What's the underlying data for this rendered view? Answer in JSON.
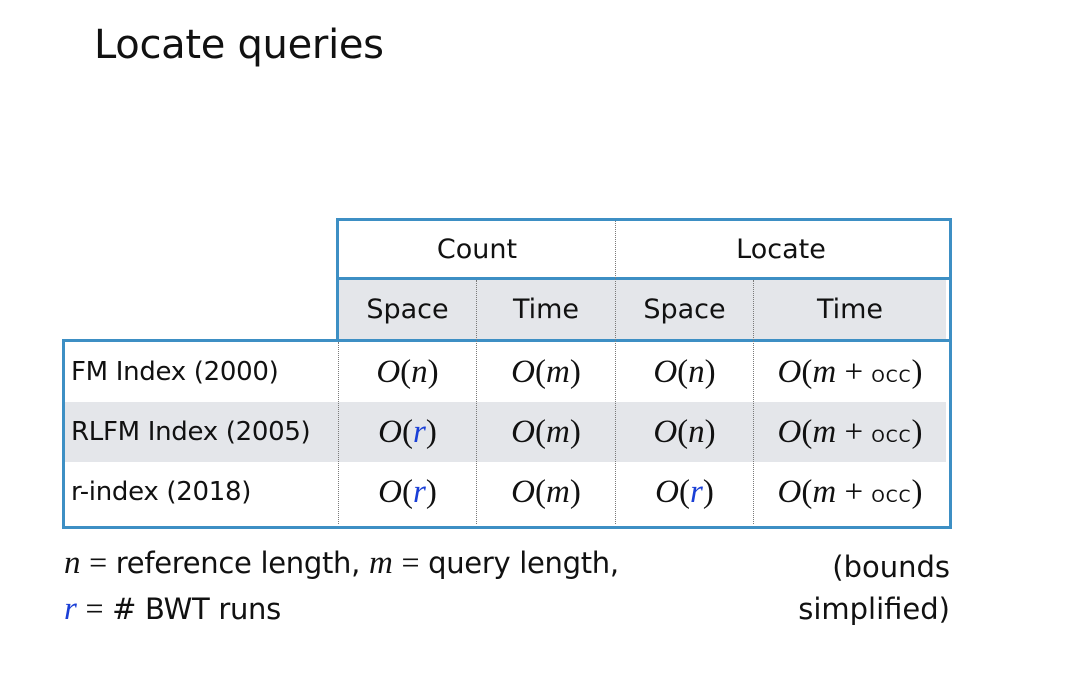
{
  "slide": {
    "title": "Locate queries"
  },
  "table": {
    "group_headers": [
      "Count",
      "Locate"
    ],
    "sub_headers": [
      "Space",
      "Time",
      "Space",
      "Time"
    ],
    "rows": [
      {
        "label": "FM Index (2000)",
        "count_space": {
          "fn": "O",
          "var": "n",
          "var_color": "default"
        },
        "count_time": {
          "fn": "O",
          "var": "m",
          "var_color": "default"
        },
        "locate_space": {
          "fn": "O",
          "var": "n",
          "var_color": "default"
        },
        "locate_time": {
          "fn": "O",
          "var": "m",
          "plus": "+",
          "occ": "occ"
        }
      },
      {
        "label": "RLFM Index (2005)",
        "count_space": {
          "fn": "O",
          "var": "r",
          "var_color": "blue"
        },
        "count_time": {
          "fn": "O",
          "var": "m",
          "var_color": "default"
        },
        "locate_space": {
          "fn": "O",
          "var": "n",
          "var_color": "default"
        },
        "locate_time": {
          "fn": "O",
          "var": "m",
          "plus": "+",
          "occ": "occ"
        }
      },
      {
        "label": "r-index (2018)",
        "count_space": {
          "fn": "O",
          "var": "r",
          "var_color": "blue"
        },
        "count_time": {
          "fn": "O",
          "var": "m",
          "var_color": "default"
        },
        "locate_space": {
          "fn": "O",
          "var": "r",
          "var_color": "blue"
        },
        "locate_time": {
          "fn": "O",
          "var": "m",
          "plus": "+",
          "occ": "occ"
        }
      }
    ]
  },
  "notes": {
    "line1": {
      "var_n": "n",
      "eq": "=",
      "text_n": "reference length,",
      "var_m": "m",
      "eq2": "=",
      "text_m": "query length,"
    },
    "line2": {
      "var_r": "r",
      "eq": "=",
      "text_r": "# BWT runs"
    },
    "bounds_line1": "(bounds",
    "bounds_line2": "simplified)"
  },
  "colors": {
    "border": "#3d8fc4",
    "header_shade": "#e4e6ea",
    "r_variable": "#1a3fd6"
  }
}
